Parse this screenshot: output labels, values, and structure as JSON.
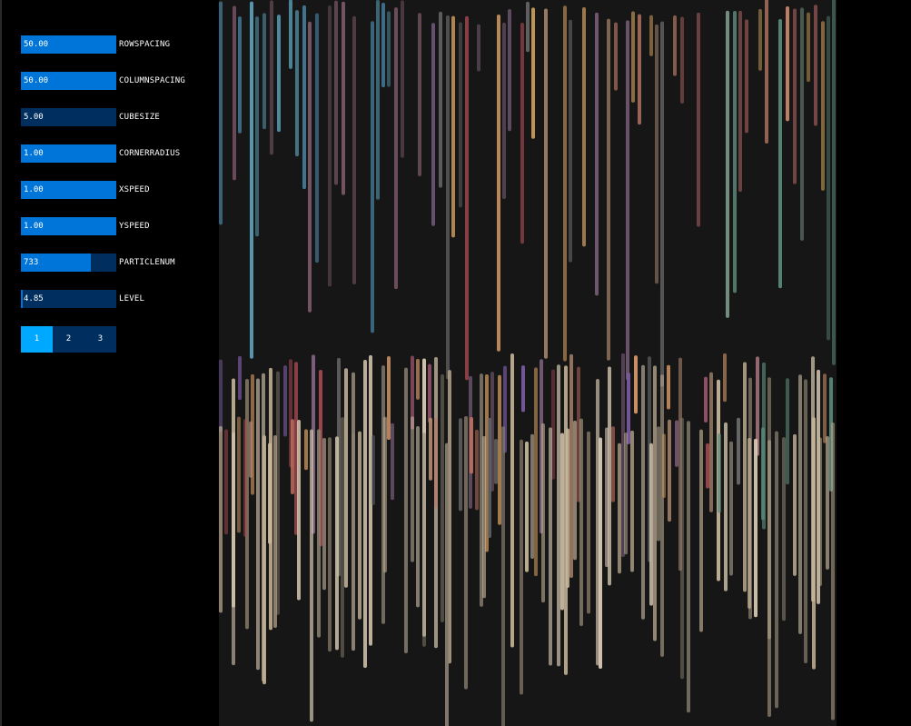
{
  "controls": {
    "sliders": [
      {
        "label": "ROWSPACING",
        "value": "50.00",
        "fraction": 1.0
      },
      {
        "label": "COLUMNSPACING",
        "value": "50.00",
        "fraction": 1.0
      },
      {
        "label": "CUBESIZE",
        "value": "5.00",
        "fraction": 0.0
      },
      {
        "label": "CORNERRADIUS",
        "value": "1.00",
        "fraction": 1.0
      },
      {
        "label": "XSPEED",
        "value": "1.00",
        "fraction": 1.0
      },
      {
        "label": "YSPEED",
        "value": "1.00",
        "fraction": 1.0
      },
      {
        "label": "PARTICLENUM",
        "value": "733",
        "fraction": 0.73
      },
      {
        "label": "LEVEL",
        "value": "4.85",
        "fraction": 0.02
      }
    ],
    "tabs": [
      {
        "label": "1",
        "active": true
      },
      {
        "label": "2",
        "active": false
      },
      {
        "label": "3",
        "active": false
      }
    ]
  },
  "colors": {
    "track": "#002f5f",
    "fill": "#0075d9",
    "tab_active": "#00a9ff",
    "background": "#000000"
  }
}
